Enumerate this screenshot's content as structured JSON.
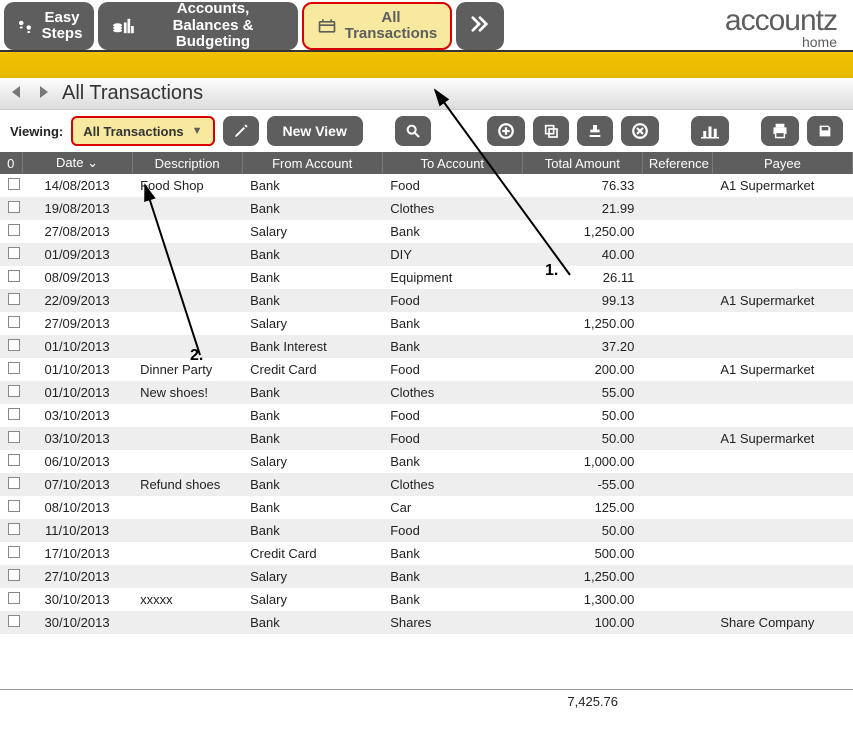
{
  "brand": {
    "name": "accountz",
    "sub": "home"
  },
  "tabs": {
    "easy": "Easy Steps",
    "acct": "Accounts, Balances & Budgeting",
    "alltx": "All Transactions"
  },
  "page_title": "All Transactions",
  "toolbar": {
    "viewing_label": "Viewing:",
    "view_value": "All Transactions",
    "new_view": "New View"
  },
  "columns": {
    "check": "0",
    "date": "Date",
    "desc": "Description",
    "from": "From Account",
    "to": "To Account",
    "amount": "Total Amount",
    "ref": "Reference",
    "payee": "Payee"
  },
  "rows": [
    {
      "date": "14/08/2013",
      "desc": "Food Shop",
      "from": "Bank",
      "to": "Food",
      "amount": "76.33",
      "ref": "",
      "payee": "A1 Supermarket"
    },
    {
      "date": "19/08/2013",
      "desc": "",
      "from": "Bank",
      "to": "Clothes",
      "amount": "21.99",
      "ref": "",
      "payee": ""
    },
    {
      "date": "27/08/2013",
      "desc": "",
      "from": "Salary",
      "to": "Bank",
      "amount": "1,250.00",
      "ref": "",
      "payee": ""
    },
    {
      "date": "01/09/2013",
      "desc": "",
      "from": "Bank",
      "to": "DIY",
      "amount": "40.00",
      "ref": "",
      "payee": ""
    },
    {
      "date": "08/09/2013",
      "desc": "",
      "from": "Bank",
      "to": "Equipment",
      "amount": "26.11",
      "ref": "",
      "payee": ""
    },
    {
      "date": "22/09/2013",
      "desc": "",
      "from": "Bank",
      "to": "Food",
      "amount": "99.13",
      "ref": "",
      "payee": "A1 Supermarket"
    },
    {
      "date": "27/09/2013",
      "desc": "",
      "from": "Salary",
      "to": "Bank",
      "amount": "1,250.00",
      "ref": "",
      "payee": ""
    },
    {
      "date": "01/10/2013",
      "desc": "",
      "from": "Bank Interest",
      "to": "Bank",
      "amount": "37.20",
      "ref": "",
      "payee": ""
    },
    {
      "date": "01/10/2013",
      "desc": "Dinner Party",
      "from": "Credit Card",
      "to": "Food",
      "amount": "200.00",
      "ref": "",
      "payee": "A1 Supermarket"
    },
    {
      "date": "01/10/2013",
      "desc": "New shoes!",
      "from": "Bank",
      "to": "Clothes",
      "amount": "55.00",
      "ref": "",
      "payee": ""
    },
    {
      "date": "03/10/2013",
      "desc": "",
      "from": "Bank",
      "to": "Food",
      "amount": "50.00",
      "ref": "",
      "payee": ""
    },
    {
      "date": "03/10/2013",
      "desc": "",
      "from": "Bank",
      "to": "Food",
      "amount": "50.00",
      "ref": "",
      "payee": "A1 Supermarket"
    },
    {
      "date": "06/10/2013",
      "desc": "",
      "from": "Salary",
      "to": "Bank",
      "amount": "1,000.00",
      "ref": "",
      "payee": ""
    },
    {
      "date": "07/10/2013",
      "desc": "Refund shoes",
      "from": "Bank",
      "to": "Clothes",
      "amount": "-55.00",
      "ref": "",
      "payee": ""
    },
    {
      "date": "08/10/2013",
      "desc": "",
      "from": "Bank",
      "to": "Car",
      "amount": "125.00",
      "ref": "",
      "payee": ""
    },
    {
      "date": "11/10/2013",
      "desc": "",
      "from": "Bank",
      "to": "Food",
      "amount": "50.00",
      "ref": "",
      "payee": ""
    },
    {
      "date": "17/10/2013",
      "desc": "",
      "from": "Credit Card",
      "to": "Bank",
      "amount": "500.00",
      "ref": "",
      "payee": ""
    },
    {
      "date": "27/10/2013",
      "desc": "",
      "from": "Salary",
      "to": "Bank",
      "amount": "1,250.00",
      "ref": "",
      "payee": ""
    },
    {
      "date": "30/10/2013",
      "desc": "xxxxx",
      "from": "Salary",
      "to": "Bank",
      "amount": "1,300.00",
      "ref": "",
      "payee": ""
    },
    {
      "date": "30/10/2013",
      "desc": "",
      "from": "Bank",
      "to": "Shares",
      "amount": "100.00",
      "ref": "",
      "payee": "Share Company"
    }
  ],
  "total": "7,425.76",
  "annotations": {
    "one": "1.",
    "two": "2."
  }
}
